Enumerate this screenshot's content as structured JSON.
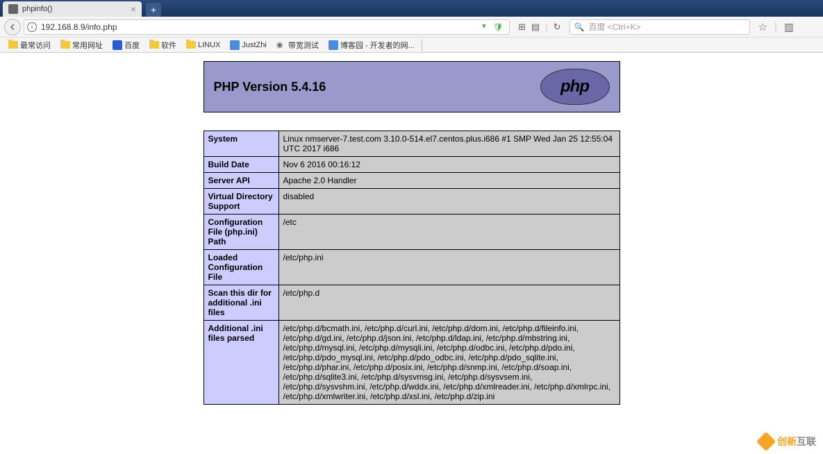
{
  "tab": {
    "title": "phpinfo()"
  },
  "nav": {
    "url": "192.168.8.9/info.php",
    "search_placeholder": "百度 <Ctrl+K>"
  },
  "bookmarks": [
    {
      "type": "folder",
      "label": "最常访问"
    },
    {
      "type": "folder",
      "label": "常用网址"
    },
    {
      "type": "baidu",
      "label": "百度"
    },
    {
      "type": "folder",
      "label": "软件"
    },
    {
      "type": "folder",
      "label": "LINUX"
    },
    {
      "type": "zhi",
      "label": "JustZhi"
    },
    {
      "type": "wifi",
      "label": "带宽测试"
    },
    {
      "type": "zhi",
      "label": "博客园 - 开发者的网..."
    }
  ],
  "php": {
    "title": "PHP Version 5.4.16",
    "logo": "php",
    "rows": [
      {
        "key": "System",
        "val": "Linux nmserver-7.test.com 3.10.0-514.el7.centos.plus.i686 #1 SMP Wed Jan 25 12:55:04 UTC 2017 i686"
      },
      {
        "key": "Build Date",
        "val": "Nov 6 2016 00:16:12"
      },
      {
        "key": "Server API",
        "val": "Apache 2.0 Handler"
      },
      {
        "key": "Virtual Directory Support",
        "val": "disabled"
      },
      {
        "key": "Configuration File (php.ini) Path",
        "val": "/etc"
      },
      {
        "key": "Loaded Configuration File",
        "val": "/etc/php.ini"
      },
      {
        "key": "Scan this dir for additional .ini files",
        "val": "/etc/php.d"
      },
      {
        "key": "Additional .ini files parsed",
        "val": "/etc/php.d/bcmath.ini, /etc/php.d/curl.ini, /etc/php.d/dom.ini, /etc/php.d/fileinfo.ini, /etc/php.d/gd.ini, /etc/php.d/json.ini, /etc/php.d/ldap.ini, /etc/php.d/mbstring.ini, /etc/php.d/mysql.ini, /etc/php.d/mysqli.ini, /etc/php.d/odbc.ini, /etc/php.d/pdo.ini, /etc/php.d/pdo_mysql.ini, /etc/php.d/pdo_odbc.ini, /etc/php.d/pdo_sqlite.ini, /etc/php.d/phar.ini, /etc/php.d/posix.ini, /etc/php.d/snmp.ini, /etc/php.d/soap.ini, /etc/php.d/sqlite3.ini, /etc/php.d/sysvmsg.ini, /etc/php.d/sysvsem.ini, /etc/php.d/sysvshm.ini, /etc/php.d/wddx.ini, /etc/php.d/xmlreader.ini, /etc/php.d/xmlrpc.ini, /etc/php.d/xmlwriter.ini, /etc/php.d/xsl.ini, /etc/php.d/zip.ini"
      }
    ]
  },
  "watermark": {
    "t1": "创新",
    "t2": "互联"
  }
}
